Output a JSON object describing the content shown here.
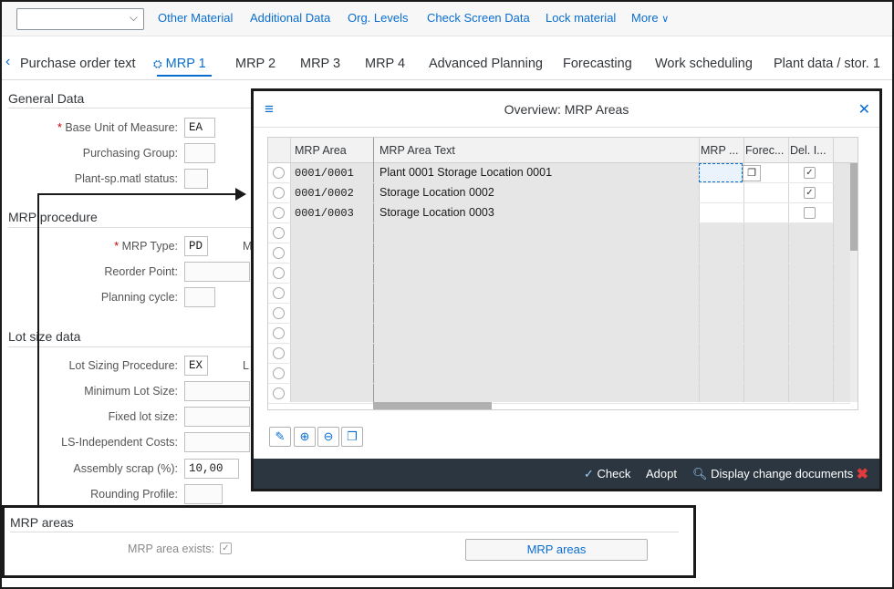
{
  "toolbar": {
    "select_value": "",
    "links": [
      "Other Material",
      "Additional Data",
      "Org. Levels",
      "Check Screen Data",
      "Lock material",
      "More"
    ]
  },
  "tabs": [
    "Purchase order text",
    "MRP 1",
    "MRP 2",
    "MRP 3",
    "MRP 4",
    "Advanced Planning",
    "Forecasting",
    "Work scheduling",
    "Plant data / stor. 1"
  ],
  "active_tab": "MRP 1",
  "general_data": {
    "title": "General Data",
    "base_uom_label": "Base Unit of Measure:",
    "base_uom_value": "EA",
    "purchasing_group_label": "Purchasing Group:",
    "plant_status_label": "Plant-sp.matl status:"
  },
  "mrp_procedure": {
    "title": "MRP procedure",
    "mrp_type_label": "MRP Type:",
    "mrp_type_value": "PD",
    "reorder_point_label": "Reorder Point:",
    "planning_cycle_label": "Planning cycle:",
    "trunc_letter": "M"
  },
  "lot_size": {
    "title": "Lot size data",
    "procedure_label": "Lot Sizing Procedure:",
    "procedure_value": "EX",
    "trunc_letter": "L",
    "min_lot_label": "Minimum Lot Size:",
    "fixed_lot_label": "Fixed lot size:",
    "ls_costs_label": "LS-Independent Costs:",
    "assembly_scrap_label": "Assembly scrap (%):",
    "assembly_scrap_value": "10,00",
    "rounding_label": "Rounding Profile:"
  },
  "mrp_areas": {
    "title": "MRP areas",
    "exists_label": "MRP area exists:",
    "exists_checked": true,
    "button_label": "MRP areas"
  },
  "dialog": {
    "title": "Overview: MRP Areas",
    "columns": [
      "MRP Area",
      "MRP Area Text",
      "MRP ...",
      "Forec...",
      "Del. I..."
    ],
    "rows": [
      {
        "area": "0001/0001",
        "text": "Plant 0001 Storage Location 0001",
        "deleted": true
      },
      {
        "area": "0001/0002",
        "text": "Storage Location 0002",
        "deleted": true
      },
      {
        "area": "0001/0003",
        "text": "Storage Location 0003",
        "deleted": false
      }
    ],
    "empty_rows": 9,
    "footer": {
      "check": "Check",
      "adopt": "Adopt",
      "display_changes": "Display change documents"
    }
  },
  "colors": {
    "accent": "#0a6ed1",
    "footer_bg": "#2b3640",
    "required": "#bb0000",
    "cancel": "#e33b3b"
  },
  "icons": [
    "chevron-down-icon",
    "back-icon",
    "mrp-tab-icon",
    "menu-icon",
    "close-icon",
    "pencil-icon",
    "add-icon",
    "remove-icon",
    "copy-icon",
    "check-icon",
    "search-icon",
    "cancel-icon"
  ]
}
